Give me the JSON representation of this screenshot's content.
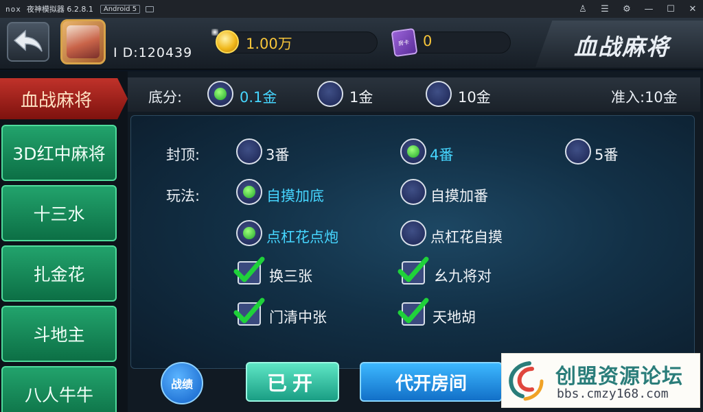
{
  "emulator": {
    "logo": "nox",
    "title": "夜神模拟器 6.2.8.1",
    "android_badge": "Android 5",
    "controls": [
      "shirt-icon",
      "menu-icon",
      "gear-icon",
      "minimize-icon",
      "maximize-icon",
      "close-icon"
    ]
  },
  "header": {
    "user_id": "I D:120439",
    "gold": "1.00万",
    "room_cards": "0",
    "card_icon_text": "房卡",
    "game_title": "血战麻将"
  },
  "sidebar": {
    "active": "血战麻将",
    "items": [
      "3D红中麻将",
      "十三水",
      "扎金花",
      "斗地主",
      "八人牛牛"
    ]
  },
  "base_score": {
    "label": "底分:",
    "options": [
      {
        "text": "0.1金",
        "selected": true
      },
      {
        "text": "1金",
        "selected": false
      },
      {
        "text": "10金",
        "selected": false
      }
    ],
    "entry": "准入:10金"
  },
  "cap": {
    "label": "封顶:",
    "options": [
      {
        "text": "3番",
        "selected": false
      },
      {
        "text": "4番",
        "selected": true
      },
      {
        "text": "5番",
        "selected": false
      }
    ]
  },
  "rules": {
    "label": "玩法:",
    "radio_rows": [
      [
        {
          "text": "自摸加底",
          "selected": true
        },
        {
          "text": "自摸加番",
          "selected": false
        }
      ],
      [
        {
          "text": "点杠花点炮",
          "selected": true
        },
        {
          "text": "点杠花自摸",
          "selected": false
        }
      ]
    ],
    "checks": [
      {
        "text": "换三张",
        "checked": true
      },
      {
        "text": "幺九将对",
        "checked": true
      },
      {
        "text": "门清中张",
        "checked": true
      },
      {
        "text": "天地胡",
        "checked": true
      }
    ]
  },
  "buttons": {
    "record": "战绩",
    "opened": "已开",
    "open_for_others": "代开房间"
  },
  "watermark": {
    "title": "创盟资源论坛",
    "url": "bbs.cmzy168.com"
  },
  "colors": {
    "selected_text": "#46d6ff",
    "tab_active": "#c0322a",
    "tab": "#22a36c",
    "gold": "#f7c53a"
  }
}
